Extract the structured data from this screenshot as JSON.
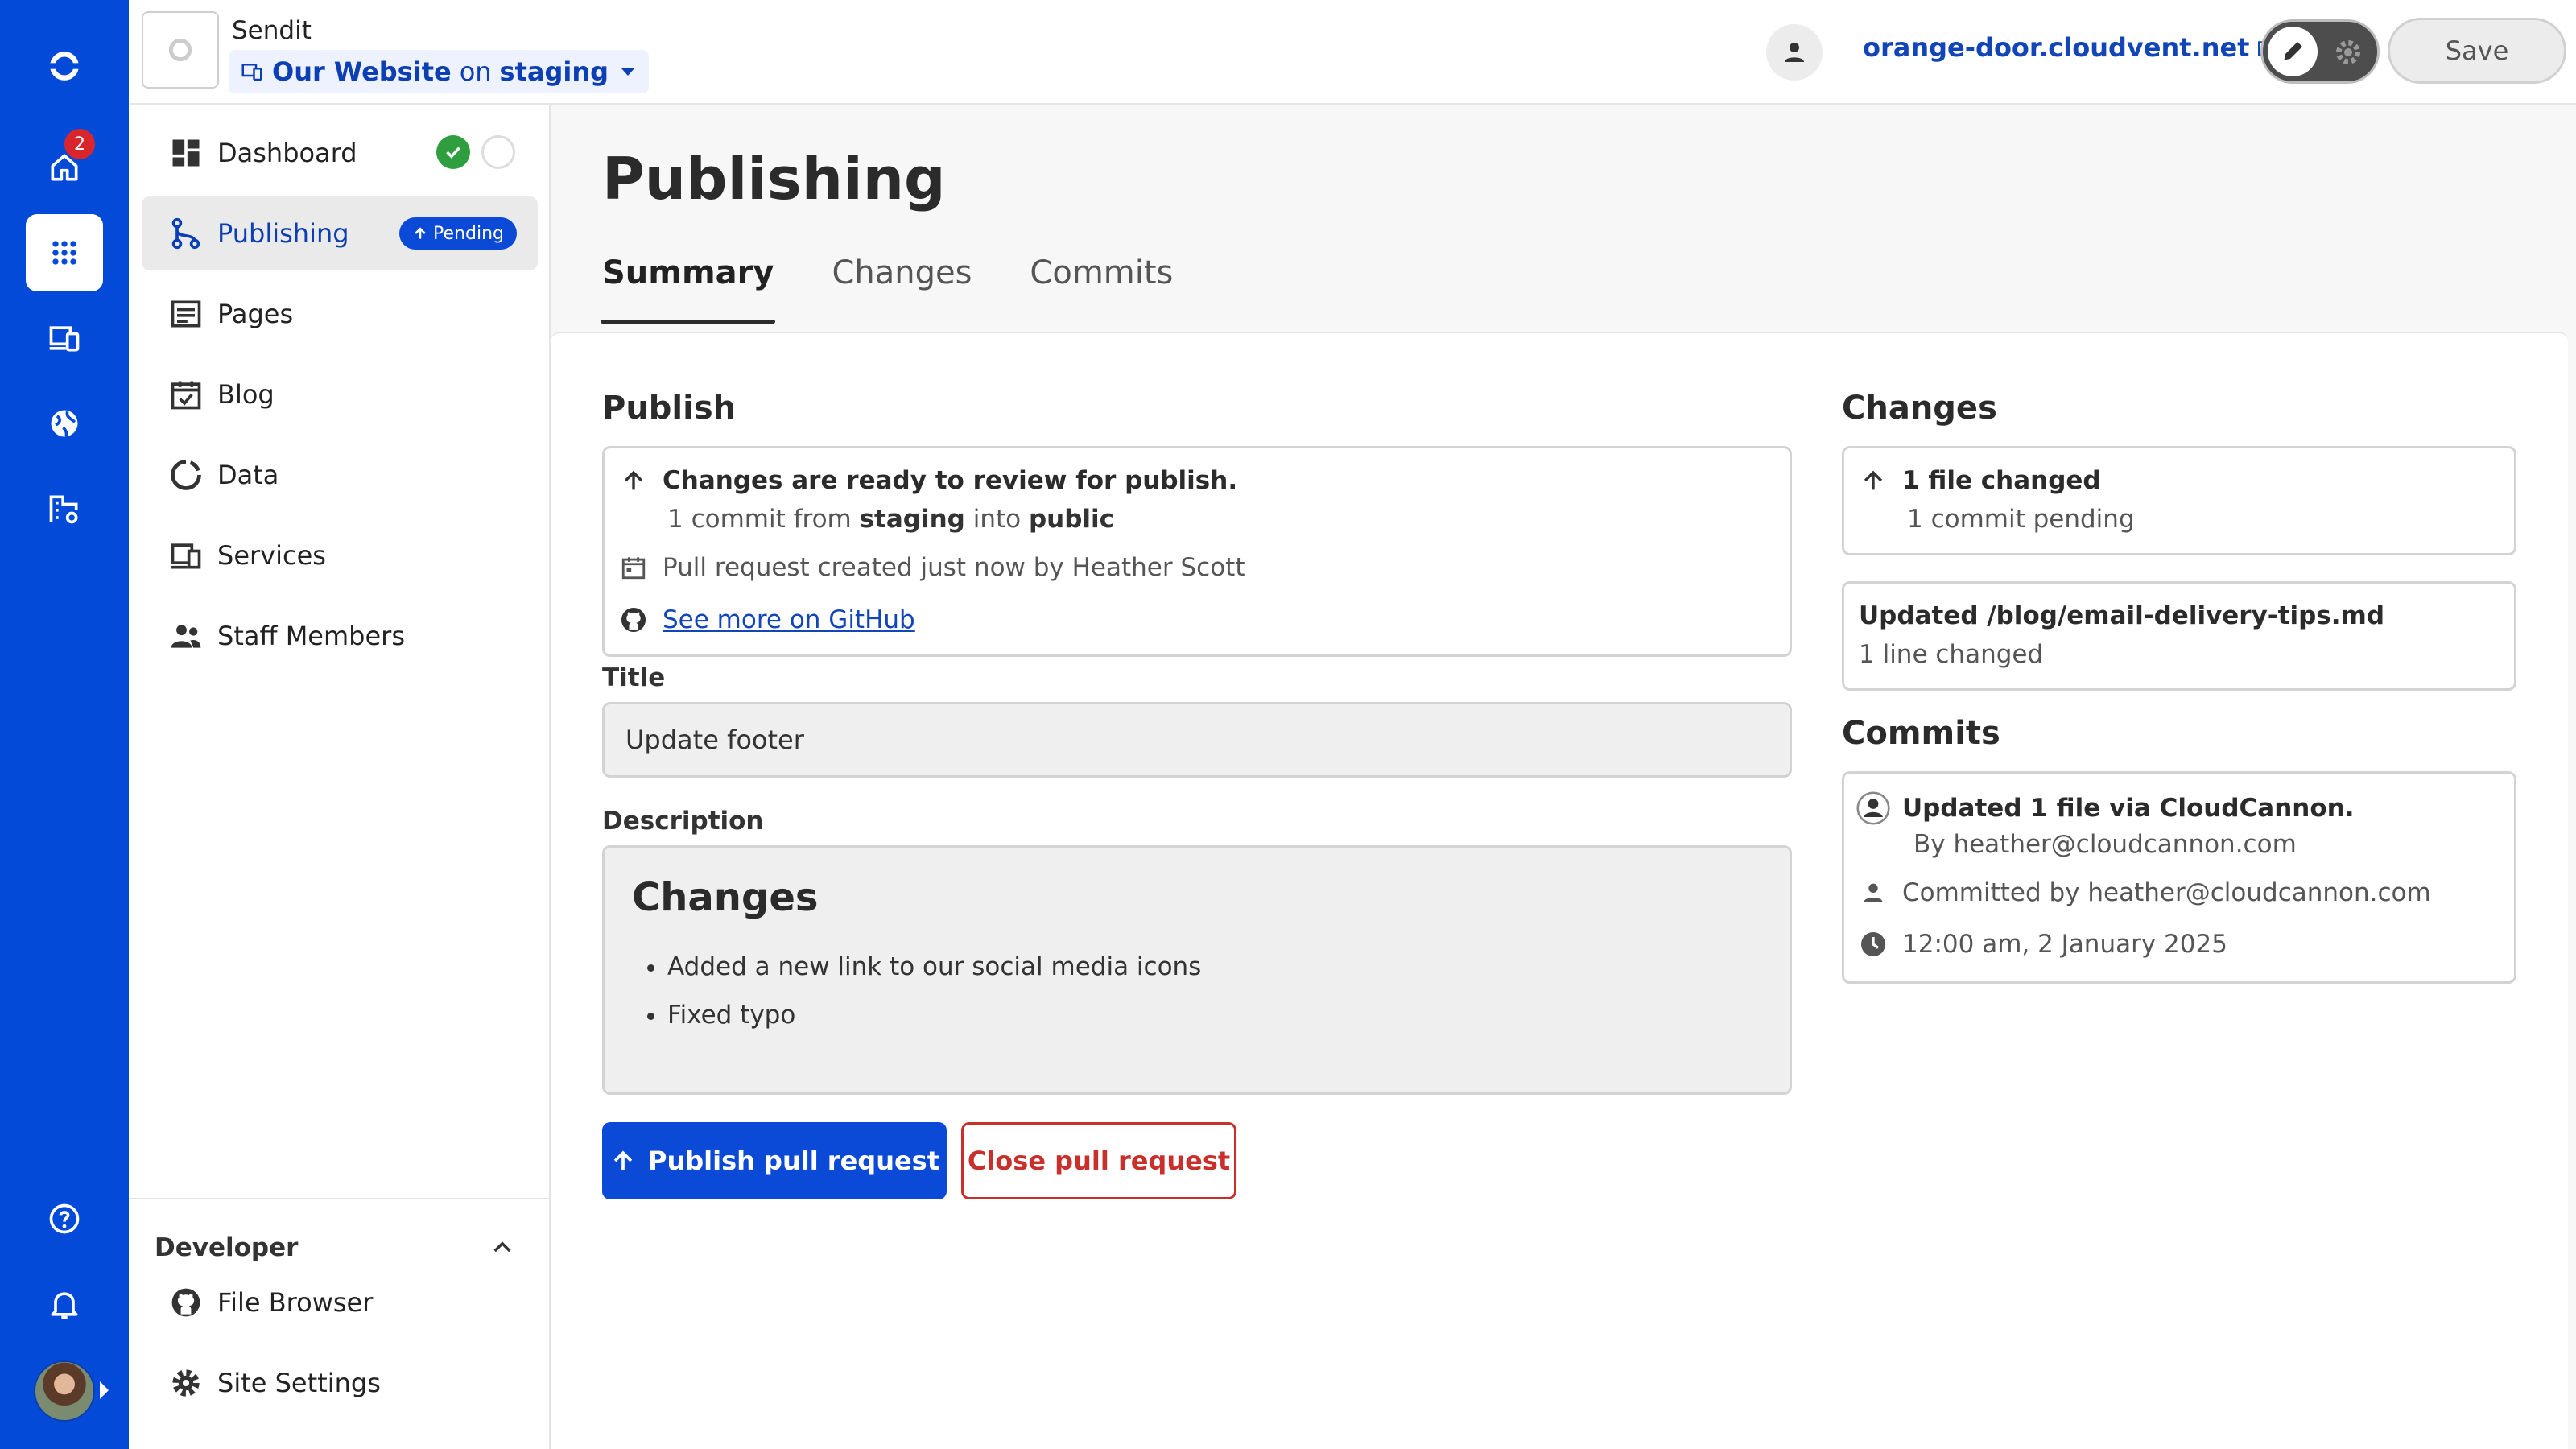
{
  "rail": {
    "home_badge": "2",
    "colors": {
      "bg": "#034ad8",
      "badge": "#d9262c"
    },
    "items": [
      {
        "name": "home-icon"
      },
      {
        "name": "apps-grid-icon"
      },
      {
        "name": "devices-icon"
      },
      {
        "name": "globe-icon"
      },
      {
        "name": "organization-settings-icon"
      },
      {
        "name": "help-icon"
      },
      {
        "name": "bell-icon"
      }
    ]
  },
  "topbar": {
    "org_name": "Sendit",
    "site_name": "Our Website",
    "branch_prefix": "on",
    "branch": "staging",
    "domain": "orange-door.cloudvent.net",
    "save_label": "Save"
  },
  "sidebar": {
    "items": [
      {
        "label": "Dashboard",
        "icon": "dashboard-icon"
      },
      {
        "label": "Publishing",
        "icon": "branch-icon",
        "badge": "Pending"
      },
      {
        "label": "Pages",
        "icon": "page-icon"
      },
      {
        "label": "Blog",
        "icon": "calendar-icon"
      },
      {
        "label": "Data",
        "icon": "data-icon"
      },
      {
        "label": "Services",
        "icon": "services-icon"
      },
      {
        "label": "Staff Members",
        "icon": "people-icon"
      }
    ],
    "developer": {
      "title": "Developer",
      "items": [
        {
          "label": "File Browser",
          "icon": "github-icon"
        },
        {
          "label": "Site Settings",
          "icon": "gear-icon"
        }
      ]
    }
  },
  "main": {
    "title": "Publishing",
    "tabs": [
      "Summary",
      "Changes",
      "Commits"
    ],
    "publish": {
      "heading": "Publish",
      "ready_text": "Changes are ready to review for publish.",
      "commit_count_text": "1 commit from",
      "source_branch": "staging",
      "into_text": "into",
      "target_branch": "public",
      "pr_text": "Pull request created just now by Heather Scott",
      "github_link": "See more on GitHub"
    },
    "title_field": {
      "label": "Title",
      "value": "Update footer"
    },
    "description": {
      "label": "Description",
      "heading": "Changes",
      "items": [
        "Added a new link to our social media icons",
        "Fixed typo"
      ]
    },
    "actions": {
      "publish": "Publish pull request",
      "close": "Close pull request"
    },
    "changes": {
      "heading": "Changes",
      "files_changed": "1 file changed",
      "commits_pending": "1 commit pending",
      "file_path": "Updated /blog/email-delivery-tips.md",
      "lines_changed": "1 line changed"
    },
    "commits": {
      "heading": "Commits",
      "title": "Updated 1 file via CloudCannon.",
      "author": "By heather@cloudcannon.com",
      "committer": "Committed by heather@cloudcannon.com",
      "time": "12:00 am, 2 January 2025"
    }
  }
}
